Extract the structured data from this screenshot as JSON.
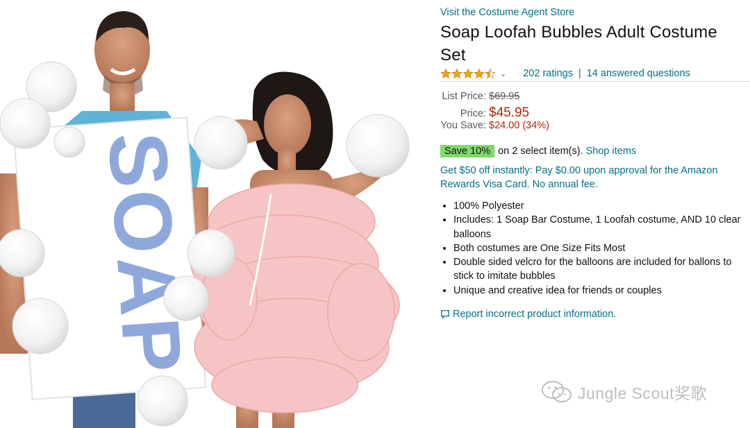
{
  "product": {
    "store_link": "Visit the Costume Agent Store",
    "title": "Soap Loofah Bubbles Adult Costume Set",
    "rating": 4.5,
    "ratings_count": "202 ratings",
    "answered_questions": "14 answered questions",
    "separator": "|"
  },
  "pricing": {
    "list_price_label": "List Price:",
    "list_price": "$69.95",
    "price_label": "Price:",
    "price": "$45.95",
    "you_save_label": "You Save:",
    "you_save": "$24.00 (34%)"
  },
  "coupon": {
    "badge": "Save 10%",
    "text": "on 2 select item(s).",
    "link": "Shop items",
    "badge_color": "#7fda69"
  },
  "promo": {
    "text": "Get $50 off instantly: Pay $0.00 upon approval for the Amazon Rewards Visa Card. No annual fee."
  },
  "features": [
    "100% Polyester",
    "Includes: 1 Soap Bar Costume, 1 Loofah costume, AND 10 clear balloons",
    "Both costumes are One Size Fits Most",
    "Double sided velcro for the balloons are included for ballons to stick to imitate bubbles",
    "Unique and creative idea for friends or couples"
  ],
  "report_link": "Report incorrect product information.",
  "image": {
    "soap_text": "SOAP"
  },
  "watermark": "Jungle Scout奖歌",
  "colors": {
    "link": "#007185",
    "price": "#b12704",
    "star": "#f0a31c",
    "loofah": "#f6c4c4"
  }
}
